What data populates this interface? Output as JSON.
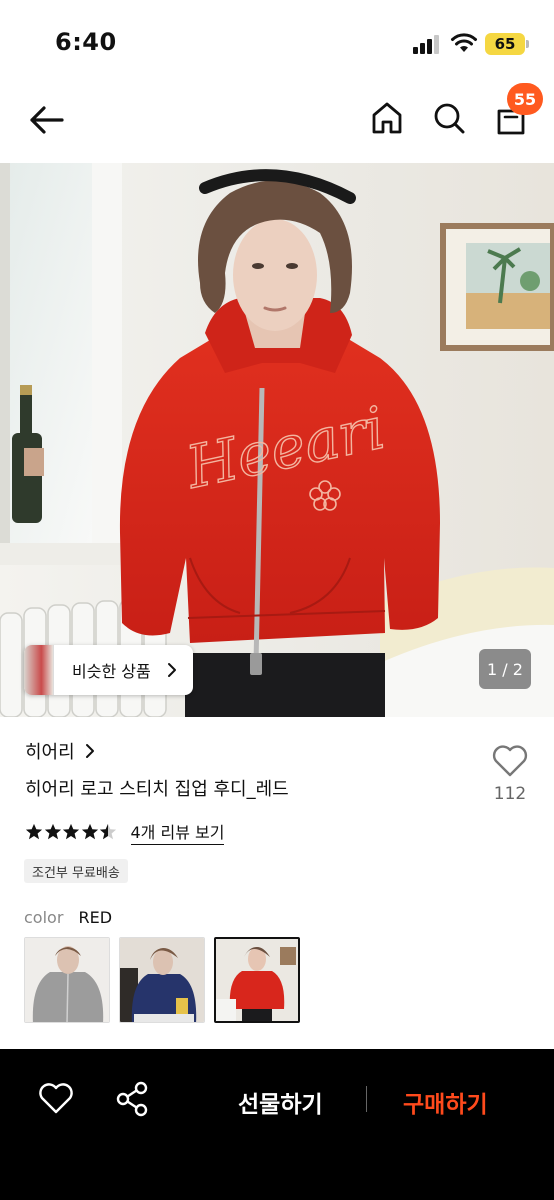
{
  "status": {
    "time": "6:40",
    "battery": "65"
  },
  "nav": {
    "cart_count": "55"
  },
  "image": {
    "similar_label": "비슷한 상품",
    "counter": "1 / 2"
  },
  "product": {
    "brand": "히어리",
    "title": "히어리 로고 스티치 집업 후디_레드",
    "like_count": "112",
    "rating": 4.5,
    "review_link": "4개 리뷰 보기",
    "shipping_badge": "조건부 무료배송",
    "option_label": "color",
    "option_value": "RED",
    "print_text": "Heeari"
  },
  "colors": {
    "accent": "#ff4a1c",
    "badge": "#ff5a1f",
    "hoodie_red": "#d8261c"
  },
  "bottom": {
    "gift_label": "선물하기",
    "buy_label": "구매하기"
  }
}
